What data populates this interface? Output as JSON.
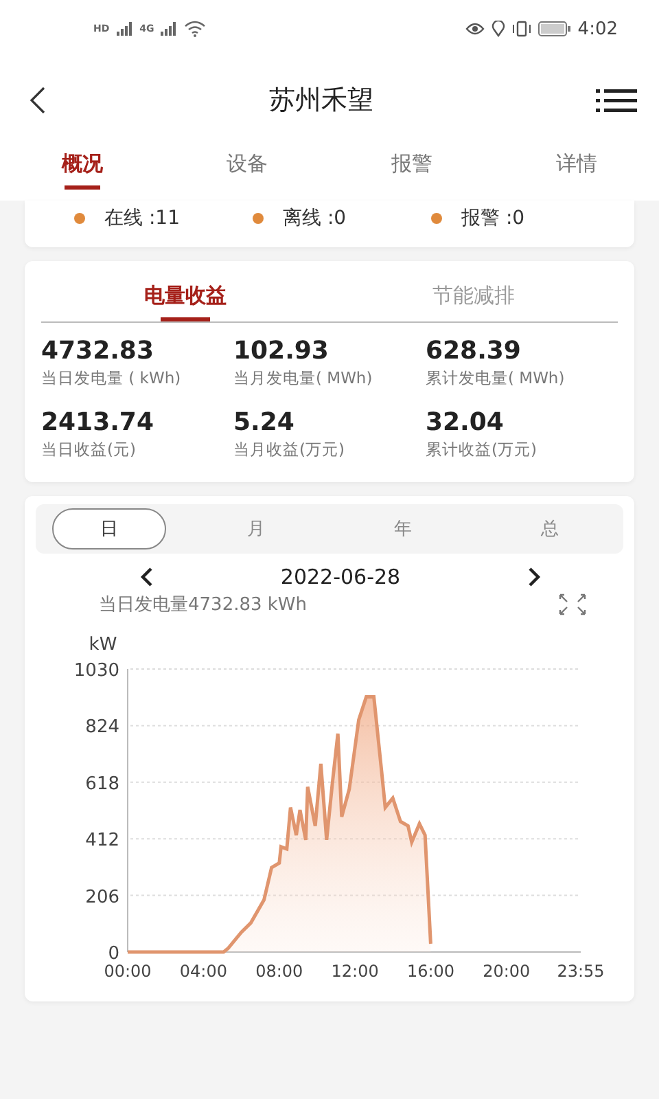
{
  "status_bar": {
    "network_badges": [
      "HD",
      "4G"
    ],
    "time": "4:02"
  },
  "header": {
    "title": "苏州禾望"
  },
  "tabs": [
    {
      "label": "概况",
      "selected": true
    },
    {
      "label": "设备",
      "selected": false
    },
    {
      "label": "报警",
      "selected": false
    },
    {
      "label": "详情",
      "selected": false
    }
  ],
  "device_status": [
    {
      "label": "在线 :11"
    },
    {
      "label": "离线 :0"
    },
    {
      "label": "报警 :0"
    }
  ],
  "stats_card": {
    "tabs": [
      {
        "label": "电量收益",
        "selected": true
      },
      {
        "label": "节能减排",
        "selected": false
      }
    ],
    "stats": [
      {
        "value": "4732.83",
        "label": "当日发电量 ( kWh)"
      },
      {
        "value": "102.93",
        "label": "当月发电量( MWh)"
      },
      {
        "value": "628.39",
        "label": "累计发电量( MWh)"
      },
      {
        "value": "2413.74",
        "label": "当日收益(元)"
      },
      {
        "value": "5.24",
        "label": "当月收益(万元)"
      },
      {
        "value": "32.04",
        "label": "累计收益(万元)"
      }
    ]
  },
  "chart_card": {
    "periods": [
      {
        "label": "日",
        "selected": true
      },
      {
        "label": "月",
        "selected": false
      },
      {
        "label": "年",
        "selected": false
      },
      {
        "label": "总",
        "selected": false
      }
    ],
    "date": "2022-06-28",
    "summary": "当日发电量4732.83 kWh",
    "chart_data": {
      "type": "area",
      "ylabel": "kW",
      "x": [
        0,
        5.07,
        5.3,
        6.0,
        6.5,
        7.2,
        7.6,
        8.0,
        8.1,
        8.4,
        8.6,
        8.9,
        9.1,
        9.4,
        9.5,
        9.9,
        10.2,
        10.5,
        10.8,
        11.1,
        11.3,
        11.7,
        12.2,
        12.6,
        13.0,
        13.4,
        13.6,
        14.0,
        14.4,
        14.8,
        15.0,
        15.4,
        15.7,
        16.0
      ],
      "grid": true,
      "series": [
        {
          "color": "#e0956e",
          "values": [
            0,
            0,
            13,
            72,
            106,
            190,
            307,
            324,
            383,
            375,
            526,
            425,
            517,
            408,
            601,
            459,
            685,
            408,
            610,
            795,
            492,
            593,
            845,
            929,
            929,
            660,
            526,
            560,
            475,
            459,
            400,
            467,
            425,
            30
          ]
        }
      ],
      "xlim": [
        0,
        23.92
      ],
      "ylim": [
        0,
        1030
      ],
      "yticks": [
        0,
        206,
        412,
        618,
        824,
        1030
      ],
      "xticks": [
        {
          "value": 0,
          "label": "00:00"
        },
        {
          "value": 4,
          "label": "04:00"
        },
        {
          "value": 8,
          "label": "08:00"
        },
        {
          "value": 12,
          "label": "12:00"
        },
        {
          "value": 16,
          "label": "16:00"
        },
        {
          "value": 20,
          "label": "20:00"
        },
        {
          "value": 23.92,
          "label": "23:55"
        }
      ]
    }
  }
}
